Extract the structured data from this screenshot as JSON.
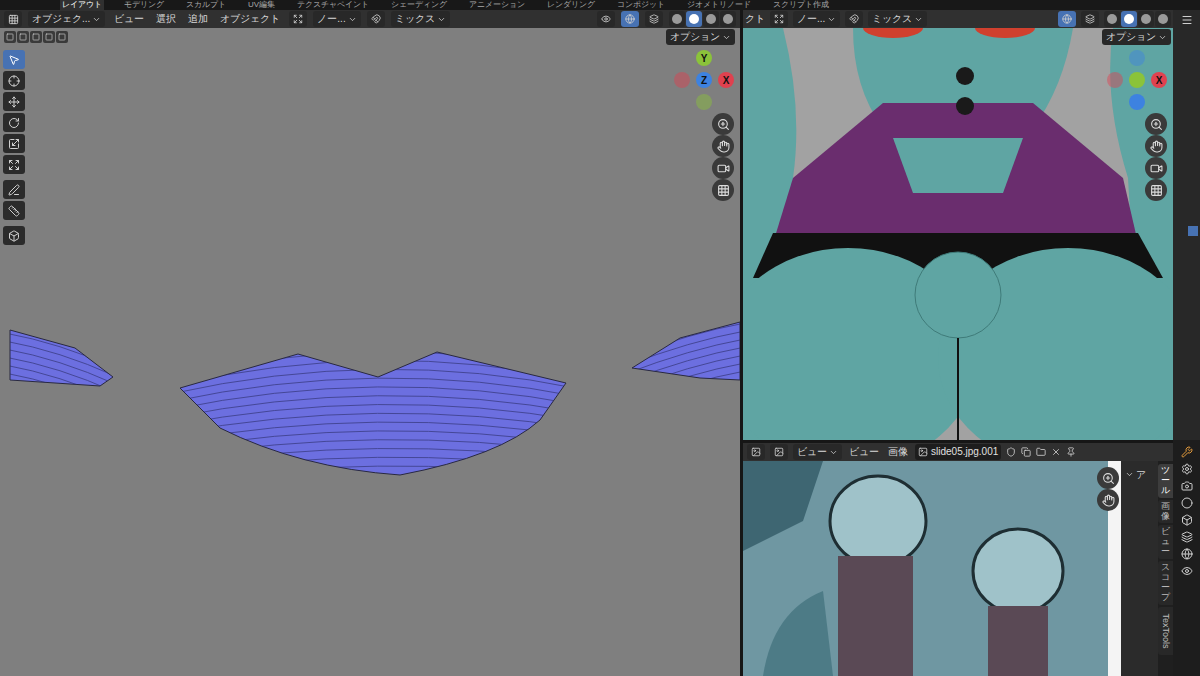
{
  "workspace_tabs": [
    {
      "label": "レイアウト",
      "selected": true
    },
    {
      "label": "モデリング",
      "selected": false
    },
    {
      "label": "スカルプト",
      "selected": false
    },
    {
      "label": "UV編集",
      "selected": false
    },
    {
      "label": "テクスチャペイント",
      "selected": false
    },
    {
      "label": "シェーディング",
      "selected": false
    },
    {
      "label": "アニメーション",
      "selected": false
    },
    {
      "label": "レンダリング",
      "selected": false
    },
    {
      "label": "コンポジット",
      "selected": false
    },
    {
      "label": "ジオメトリノード",
      "selected": false
    },
    {
      "label": "スクリプト作成",
      "selected": false
    }
  ],
  "uv_editor": {
    "mode": "オブジェク...",
    "menus": [
      "ビュー",
      "選択",
      "追加",
      "オブジェクト"
    ],
    "orientation": "ノー...",
    "blend": "ミックス",
    "options": "オプション",
    "shading": [
      {
        "selected": false
      },
      {
        "selected": true
      },
      {
        "selected": false
      },
      {
        "selected": false
      }
    ],
    "tools": [
      {
        "kind": "select",
        "selected": true
      },
      {
        "kind": "cursor",
        "selected": false
      },
      {
        "kind": "move",
        "selected": false
      },
      {
        "kind": "rotate",
        "selected": false
      },
      {
        "kind": "scale",
        "selected": false
      },
      {
        "kind": "transform",
        "selected": false
      },
      {
        "kind": "annotate",
        "selected": false
      },
      {
        "kind": "measure",
        "selected": false
      },
      {
        "kind": "add",
        "selected": false
      }
    ],
    "gizmo": [
      {
        "dir": "top",
        "label": "Y",
        "color": "#8bc33a",
        "faded": false
      },
      {
        "dir": "left",
        "label": "",
        "color": "#e0414f",
        "faded": true
      },
      {
        "dir": "right",
        "label": "X",
        "color": "#e0414f",
        "faded": false
      },
      {
        "dir": "bottom",
        "label": "",
        "color": "#8bc33a",
        "faded": true
      },
      {
        "dir": "center",
        "label": "Z",
        "color": "#3d82e0",
        "faded": false
      }
    ]
  },
  "viewport": {
    "mode": "クト",
    "orientation": "ノー...",
    "blend": "ミックス",
    "options": "オプション",
    "shading": [
      {
        "selected": false
      },
      {
        "selected": true
      },
      {
        "selected": false
      },
      {
        "selected": false
      }
    ],
    "gizmo": [
      {
        "dir": "top",
        "label": "",
        "color": "#3d82e0",
        "faded": true
      },
      {
        "dir": "left",
        "label": "",
        "color": "#e0414f",
        "faded": true
      },
      {
        "dir": "right",
        "label": "X",
        "color": "#e0414f",
        "faded": false
      },
      {
        "dir": "bottom",
        "label": "",
        "color": "#3d82e0",
        "faded": false
      },
      {
        "dir": "center",
        "label": "",
        "color": "#8bc33a",
        "faded": false
      }
    ]
  },
  "image_editor": {
    "view_mode": "ビュー",
    "menus": [
      "ビュー",
      "画像"
    ],
    "image_name": "slide05.jpg.001",
    "panel_title": "ア",
    "sidebar_tabs": [
      {
        "label": "ツール",
        "kind": "cjk",
        "selected": true
      },
      {
        "label": "画像",
        "kind": "cjk",
        "selected": false
      },
      {
        "label": "ビュー",
        "kind": "cjk",
        "selected": false
      },
      {
        "label": "スコープ",
        "kind": "cjk",
        "selected": false
      },
      {
        "label": "TexTools",
        "kind": "latin",
        "selected": false
      }
    ]
  }
}
